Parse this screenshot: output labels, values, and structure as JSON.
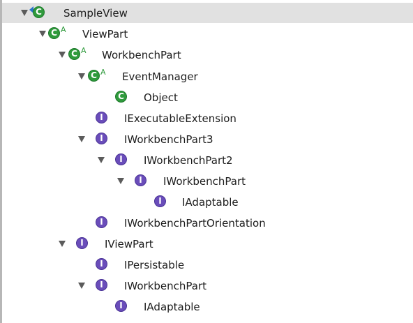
{
  "tree": {
    "nodes": [
      {
        "label": "SampleView",
        "icon": "class-icon",
        "expanded": true,
        "selected": true,
        "abstract": "",
        "depth": 0
      },
      {
        "label": "ViewPart",
        "icon": "class-icon",
        "expanded": true,
        "abstract": "A",
        "depth": 1
      },
      {
        "label": "WorkbenchPart",
        "icon": "class-icon",
        "expanded": true,
        "abstract": "A",
        "depth": 2
      },
      {
        "label": "EventManager",
        "icon": "class-icon",
        "expanded": true,
        "abstract": "A",
        "depth": 3
      },
      {
        "label": "Object",
        "icon": "class-icon",
        "expanded": false,
        "abstract": "",
        "depth": 4
      },
      {
        "label": "IExecutableExtension",
        "icon": "interface-icon",
        "expanded": false,
        "abstract": "",
        "depth": 3
      },
      {
        "label": "IWorkbenchPart3",
        "icon": "interface-icon",
        "expanded": true,
        "abstract": "",
        "depth": 3
      },
      {
        "label": "IWorkbenchPart2",
        "icon": "interface-icon",
        "expanded": true,
        "abstract": "",
        "depth": 4
      },
      {
        "label": "IWorkbenchPart",
        "icon": "interface-icon",
        "expanded": true,
        "abstract": "",
        "depth": 5
      },
      {
        "label": "IAdaptable",
        "icon": "interface-icon",
        "expanded": false,
        "abstract": "",
        "depth": 6
      },
      {
        "label": "IWorkbenchPartOrientation",
        "icon": "interface-icon",
        "expanded": false,
        "abstract": "",
        "depth": 3
      },
      {
        "label": "IViewPart",
        "icon": "interface-icon",
        "expanded": true,
        "abstract": "",
        "depth": 2
      },
      {
        "label": "IPersistable",
        "icon": "interface-icon",
        "expanded": false,
        "abstract": "",
        "depth": 3
      },
      {
        "label": "IWorkbenchPart",
        "icon": "interface-icon",
        "expanded": true,
        "abstract": "",
        "depth": 3
      },
      {
        "label": "IAdaptable",
        "icon": "interface-icon",
        "expanded": false,
        "abstract": "",
        "depth": 4
      }
    ]
  },
  "icons": {
    "class_glyph": "C",
    "interface_glyph": "I"
  },
  "colors": {
    "class_icon": "#2f9a3c",
    "interface_icon": "#6a4dba",
    "selection": "#e1e1e1",
    "text": "#1c1c1c"
  }
}
